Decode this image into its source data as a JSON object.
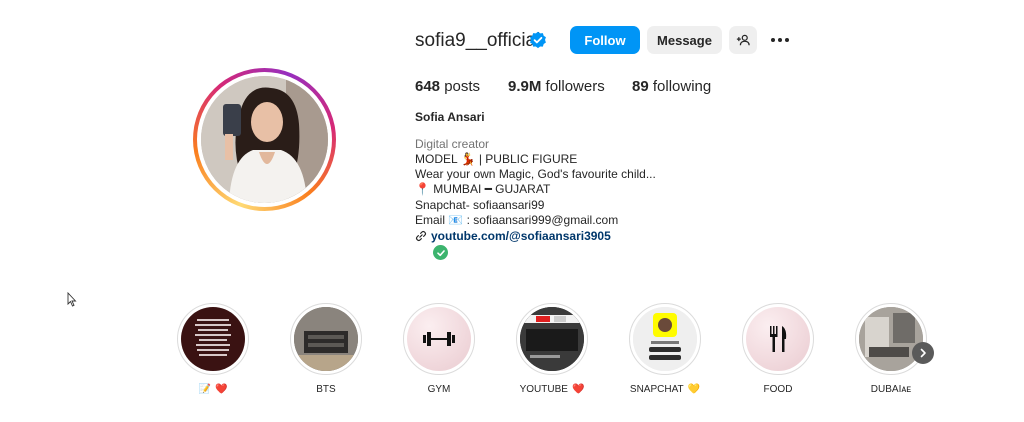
{
  "profile": {
    "username": "sofia9__official",
    "verified": true,
    "follow_label": "Follow",
    "message_label": "Message",
    "stats": {
      "posts_count": "648",
      "posts_label": "posts",
      "followers_count": "9.9M",
      "followers_label": "followers",
      "following_count": "89",
      "following_label": "following"
    },
    "full_name": "Sofia Ansari",
    "category": "Digital creator",
    "bio": {
      "line1": "MODEL 💃 | PUBLIC FIGURE",
      "line2": "Wear your own Magic, God's favourite child...",
      "line3": "📍 MUMBAI ━ GUJARAT",
      "line4": "Snapchat- sofiaansari99",
      "line5": "Email 📧 : sofiaansari999@gmail.com"
    },
    "link": "youtube.com/@sofiaansari3905"
  },
  "highlights": [
    {
      "label": "📝",
      "emoji": "❤️"
    },
    {
      "label": "BTS",
      "emoji": ""
    },
    {
      "label": "GYM",
      "emoji": ""
    },
    {
      "label": "YOUTUBE",
      "emoji": "❤️"
    },
    {
      "label": "SNAPCHAT",
      "emoji": "💛"
    },
    {
      "label": "FOOD",
      "emoji": ""
    },
    {
      "label": "DUBAIᴀᴇ",
      "emoji": ""
    }
  ],
  "colors": {
    "follow_button": "#0095f6",
    "secondary_button": "#efefef",
    "verified_badge": "#0095f6",
    "link": "#00376b"
  }
}
